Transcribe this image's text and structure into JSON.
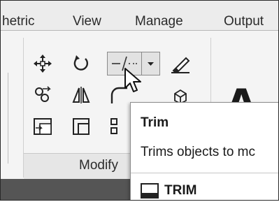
{
  "tabs": [
    {
      "label": "hetric"
    },
    {
      "label": "View"
    },
    {
      "label": "Manage"
    },
    {
      "label": "Output"
    }
  ],
  "modify_panel": {
    "label": "Modify",
    "tools": [
      "move-icon",
      "rotate-icon",
      "trim-icon",
      "erase-icon",
      "copy-icon",
      "mirror-icon",
      "fillet-icon",
      "explode-icon",
      "stretch-icon",
      "scale-icon",
      "array-icon"
    ]
  },
  "annotation_panel": {
    "text_glyph": "A"
  },
  "tooltip": {
    "title": "Trim",
    "description": "Trims objects to mc",
    "command": "TRIM",
    "command_icon": "command-line-icon"
  },
  "colors": {
    "ribbon": "#f4f4f4",
    "tooltip_bg": "#ffffff",
    "bottom_band": "#555555"
  }
}
